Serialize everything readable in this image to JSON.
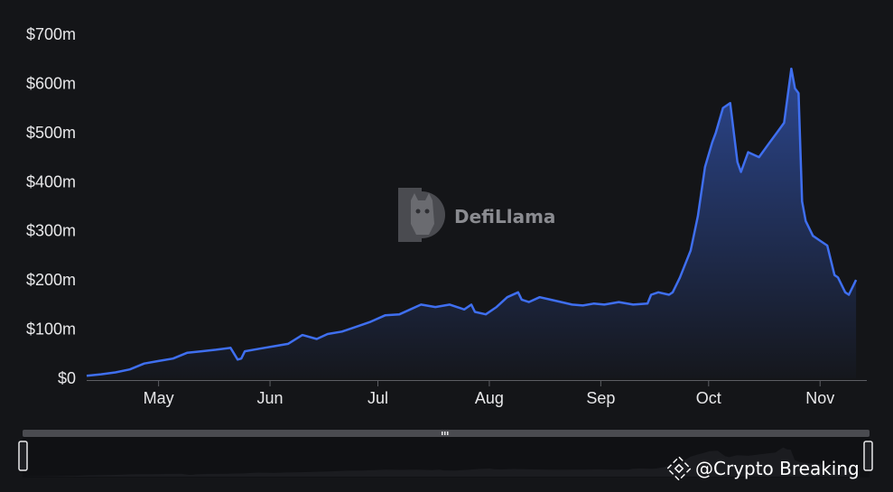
{
  "watermark": {
    "text": "DefiLlama",
    "icon": "llama-logo-icon"
  },
  "credit": {
    "text": "@Crypto Breaking",
    "icon": "binance-logo-icon"
  },
  "colors": {
    "background": "#141518",
    "line": "#3f6ff0",
    "axis": "#5d5e63",
    "text": "#e8e8ea"
  },
  "chart_data": {
    "type": "area",
    "title": "",
    "xlabel": "",
    "ylabel": "",
    "ylim": [
      0,
      700
    ],
    "yticks": [
      {
        "value": 0,
        "label": "$0"
      },
      {
        "value": 100,
        "label": "$100m"
      },
      {
        "value": 200,
        "label": "$200m"
      },
      {
        "value": 300,
        "label": "$300m"
      },
      {
        "value": 400,
        "label": "$400m"
      },
      {
        "value": 500,
        "label": "$500m"
      },
      {
        "value": 600,
        "label": "$600m"
      },
      {
        "value": 700,
        "label": "$700m"
      }
    ],
    "xrange": [
      "2023-04-11",
      "2023-11-14"
    ],
    "xticks": [
      {
        "date": "2023-05-01",
        "label": "May"
      },
      {
        "date": "2023-06-01",
        "label": "Jun"
      },
      {
        "date": "2023-07-01",
        "label": "Jul"
      },
      {
        "date": "2023-08-01",
        "label": "Aug"
      },
      {
        "date": "2023-09-01",
        "label": "Sep"
      },
      {
        "date": "2023-10-01",
        "label": "Oct"
      },
      {
        "date": "2023-11-01",
        "label": "Nov"
      }
    ],
    "grid": false,
    "series": [
      {
        "x": [
          "2023-04-11",
          "2023-04-15",
          "2023-04-19",
          "2023-04-23",
          "2023-04-27",
          "2023-05-01",
          "2023-05-05",
          "2023-05-09",
          "2023-05-13",
          "2023-05-17",
          "2023-05-21",
          "2023-05-23",
          "2023-05-24",
          "2023-05-25",
          "2023-05-29",
          "2023-06-02",
          "2023-06-06",
          "2023-06-10",
          "2023-06-14",
          "2023-06-17",
          "2023-06-21",
          "2023-06-25",
          "2023-06-29",
          "2023-07-03",
          "2023-07-07",
          "2023-07-10",
          "2023-07-13",
          "2023-07-17",
          "2023-07-21",
          "2023-07-25",
          "2023-07-27",
          "2023-07-28",
          "2023-07-31",
          "2023-08-03",
          "2023-08-06",
          "2023-08-09",
          "2023-08-10",
          "2023-08-12",
          "2023-08-15",
          "2023-08-18",
          "2023-08-21",
          "2023-08-24",
          "2023-08-27",
          "2023-08-30",
          "2023-09-02",
          "2023-09-06",
          "2023-09-10",
          "2023-09-14",
          "2023-09-15",
          "2023-09-17",
          "2023-09-20",
          "2023-09-21",
          "2023-09-23",
          "2023-09-26",
          "2023-09-28",
          "2023-09-30",
          "2023-10-02",
          "2023-10-03",
          "2023-10-05",
          "2023-10-07",
          "2023-10-09",
          "2023-10-10",
          "2023-10-11",
          "2023-10-12",
          "2023-10-15",
          "2023-10-18",
          "2023-10-20",
          "2023-10-22",
          "2023-10-24",
          "2023-10-25",
          "2023-10-26",
          "2023-10-27",
          "2023-10-28",
          "2023-10-30",
          "2023-11-01",
          "2023-11-03",
          "2023-11-05",
          "2023-11-06",
          "2023-11-08",
          "2023-11-09",
          "2023-11-11"
        ],
        "y": [
          5,
          8,
          12,
          18,
          30,
          35,
          40,
          52,
          55,
          58,
          62,
          38,
          40,
          55,
          60,
          65,
          70,
          88,
          80,
          90,
          95,
          105,
          115,
          128,
          130,
          140,
          150,
          145,
          150,
          140,
          150,
          135,
          130,
          145,
          165,
          175,
          160,
          155,
          165,
          160,
          155,
          150,
          148,
          152,
          150,
          155,
          150,
          152,
          170,
          175,
          170,
          175,
          205,
          260,
          330,
          430,
          480,
          500,
          550,
          560,
          440,
          420,
          440,
          460,
          450,
          480,
          500,
          520,
          630,
          590,
          580,
          360,
          320,
          290,
          280,
          270,
          210,
          205,
          175,
          170,
          200
        ]
      }
    ]
  }
}
